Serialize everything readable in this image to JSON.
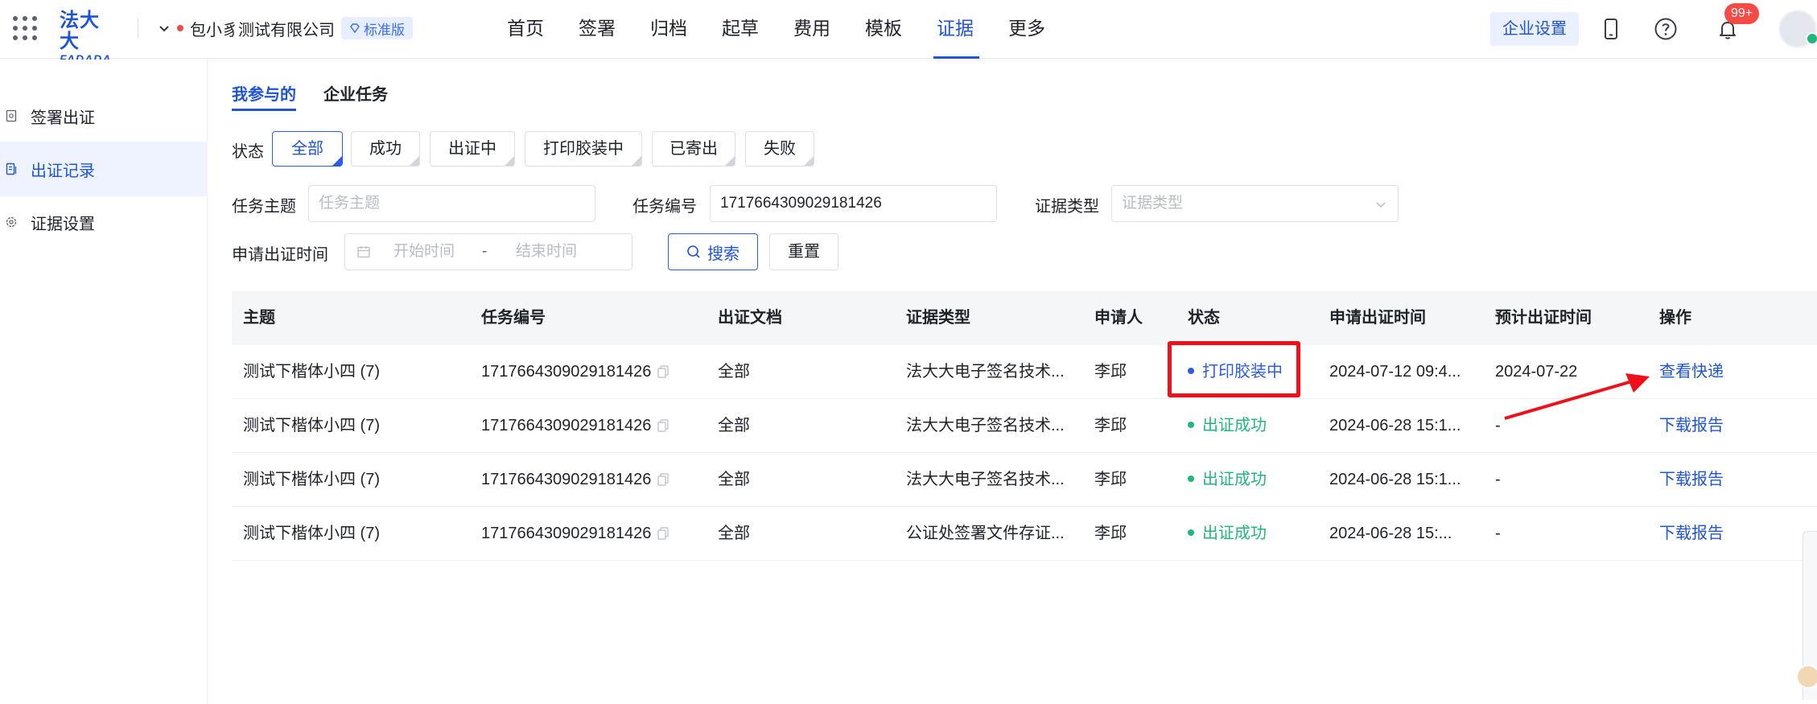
{
  "topbar": {
    "logo_cn": "法大大",
    "logo_en": "FADADA",
    "company_name": "包小豸测试有限公司",
    "edition": "标准版",
    "nav": [
      "首页",
      "签署",
      "归档",
      "起草",
      "费用",
      "模板",
      "证据",
      "更多"
    ],
    "active_nav": "证据",
    "enterprise_settings": "企业设置",
    "notification_count": "99+",
    "accent": "#1f54d6"
  },
  "sidebar": {
    "items": [
      {
        "label": "签署出证",
        "icon": "sign-cert-icon"
      },
      {
        "label": "出证记录",
        "icon": "record-icon"
      },
      {
        "label": "证据设置",
        "icon": "gear-icon"
      }
    ],
    "active": "出证记录"
  },
  "tabs": [
    "我参与的",
    "企业任务"
  ],
  "filters": {
    "status_label": "状态",
    "status_options": [
      "全部",
      "成功",
      "出证中",
      "打印胶装中",
      "已寄出",
      "失败"
    ],
    "status_selected": "全部",
    "subject_label": "任务主题",
    "subject_placeholder": "任务主题",
    "task_no_label": "任务编号",
    "task_no_value": "1717664309029181426",
    "evidence_type_label": "证据类型",
    "evidence_type_placeholder": "证据类型",
    "apply_time_label": "申请出证时间",
    "start_placeholder": "开始时间",
    "range_separator": "-",
    "end_placeholder": "结束时间",
    "search_button": "搜索",
    "reset_button": "重置"
  },
  "table": {
    "columns": [
      "主题",
      "任务编号",
      "出证文档",
      "证据类型",
      "申请人",
      "状态",
      "申请出证时间",
      "预计出证时间",
      "操作"
    ],
    "rows": [
      {
        "subject": "测试下楷体小四 (7)",
        "task_no": "1717664309029181426",
        "doc": "全部",
        "type": "法大大电子签名技术...",
        "applicant": "李邱",
        "status": "打印胶装中",
        "status_color": "#2a5ce8",
        "apply_time": "2024-07-12 09:4...",
        "expect_time": "2024-07-22",
        "action": "查看快递"
      },
      {
        "subject": "测试下楷体小四 (7)",
        "task_no": "1717664309029181426",
        "doc": "全部",
        "type": "法大大电子签名技术...",
        "applicant": "李邱",
        "status": "出证成功",
        "status_color": "#1fb87a",
        "apply_time": "2024-06-28 15:1...",
        "expect_time": "-",
        "action": "下载报告"
      },
      {
        "subject": "测试下楷体小四 (7)",
        "task_no": "1717664309029181426",
        "doc": "全部",
        "type": "法大大电子签名技术...",
        "applicant": "李邱",
        "status": "出证成功",
        "status_color": "#1fb87a",
        "apply_time": "2024-06-28 15:1...",
        "expect_time": "-",
        "action": "下载报告"
      },
      {
        "subject": "测试下楷体小四 (7)",
        "task_no": "1717664309029181426",
        "doc": "全部",
        "type": "公证处签署文件存证...",
        "applicant": "李邱",
        "status": "出证成功",
        "status_color": "#1fb87a",
        "apply_time": "2024-06-28 15:...",
        "expect_time": "-",
        "action": "下载报告"
      }
    ]
  }
}
